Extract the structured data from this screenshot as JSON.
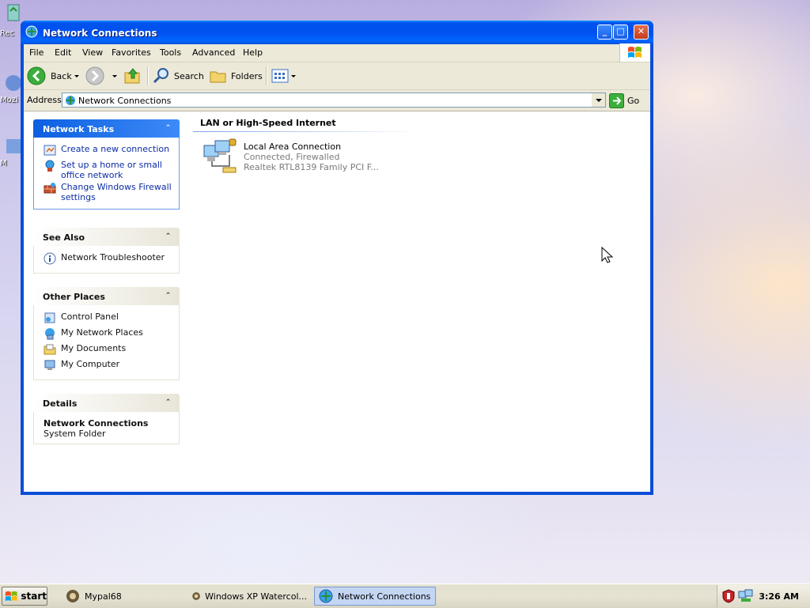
{
  "desktop": {
    "icons": [
      {
        "label": "Rec"
      },
      {
        "label": "Mozi"
      },
      {
        "label": "M"
      }
    ]
  },
  "window": {
    "title": "Network Connections",
    "buttons": {
      "minimize": "_",
      "maximize": "□",
      "close": "✕"
    }
  },
  "menubar": {
    "items": [
      "File",
      "Edit",
      "View",
      "Favorites",
      "Tools",
      "Advanced",
      "Help"
    ]
  },
  "toolbar": {
    "back_label": "Back",
    "search_label": "Search",
    "folders_label": "Folders"
  },
  "address": {
    "label": "Address",
    "value": "Network Connections",
    "go_label": "Go"
  },
  "taskpane": {
    "network_tasks": {
      "title": "Network Tasks",
      "items": [
        {
          "label": "Create a new connection",
          "icon": "new-connection-icon"
        },
        {
          "label": "Set up a home or small office network",
          "icon": "home-network-icon"
        },
        {
          "label": "Change Windows Firewall settings",
          "icon": "firewall-icon"
        }
      ]
    },
    "see_also": {
      "title": "See Also",
      "items": [
        {
          "label": "Network Troubleshooter",
          "icon": "info-icon"
        }
      ]
    },
    "other_places": {
      "title": "Other Places",
      "items": [
        {
          "label": "Control Panel",
          "icon": "control-panel-icon"
        },
        {
          "label": "My Network Places",
          "icon": "network-places-icon"
        },
        {
          "label": "My Documents",
          "icon": "documents-icon"
        },
        {
          "label": "My Computer",
          "icon": "computer-icon"
        }
      ]
    },
    "details": {
      "title": "Details",
      "name": "Network Connections",
      "type": "System Folder"
    }
  },
  "content": {
    "section_title": "LAN or High-Speed Internet",
    "connections": [
      {
        "name": "Local Area Connection",
        "status": "Connected, Firewalled",
        "device": "Realtek RTL8139 Family PCI F..."
      }
    ]
  },
  "taskbar": {
    "start_label": "start",
    "tasks": [
      {
        "label": "Mypal68"
      },
      {
        "label": "Windows XP Watercol..."
      },
      {
        "label": "Network Connections",
        "active": true
      }
    ],
    "clock": "3:26 AM"
  },
  "colors": {
    "xp_blue": "#0053ee",
    "link_blue": "#0c2ca6",
    "start_green": "#3a9d23"
  }
}
